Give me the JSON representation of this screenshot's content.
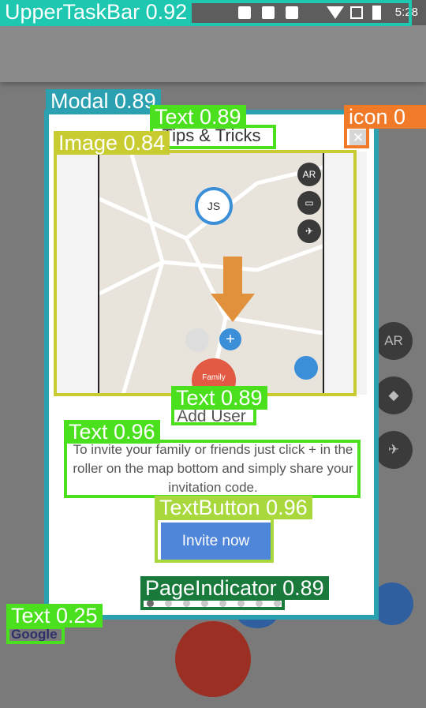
{
  "status_bar": {
    "time": "5:28"
  },
  "background_buttons": [
    "AR"
  ],
  "modal": {
    "title": "Tips & Tricks",
    "close_icon": "close-icon",
    "map": {
      "pin_initials": "JS",
      "ar_label": "AR",
      "family_label": "Family"
    },
    "heading": "Add User",
    "body": "To invite your family or friends just click + in the roller on the map bottom and simply share your invitation code.",
    "button_label": "Invite now",
    "page_count": 8,
    "active_page": 1
  },
  "google_logo": "Google",
  "annotations": {
    "upper_task_bar": "UpperTaskBar 0.92",
    "modal": "Modal 0.89",
    "title_text": "Text 0.89",
    "icon": "icon 0",
    "image": "Image 0.84",
    "heading_text": "Text 0.89",
    "body_text": "Text 0.96",
    "text_button": "TextButton 0.96",
    "page_indicator": "PageIndicator 0.89",
    "google_text": "Text 0.25"
  },
  "colors": {
    "modal_border": "#2aa0b0",
    "button": "#4f86d9",
    "green": "#4be01d"
  }
}
